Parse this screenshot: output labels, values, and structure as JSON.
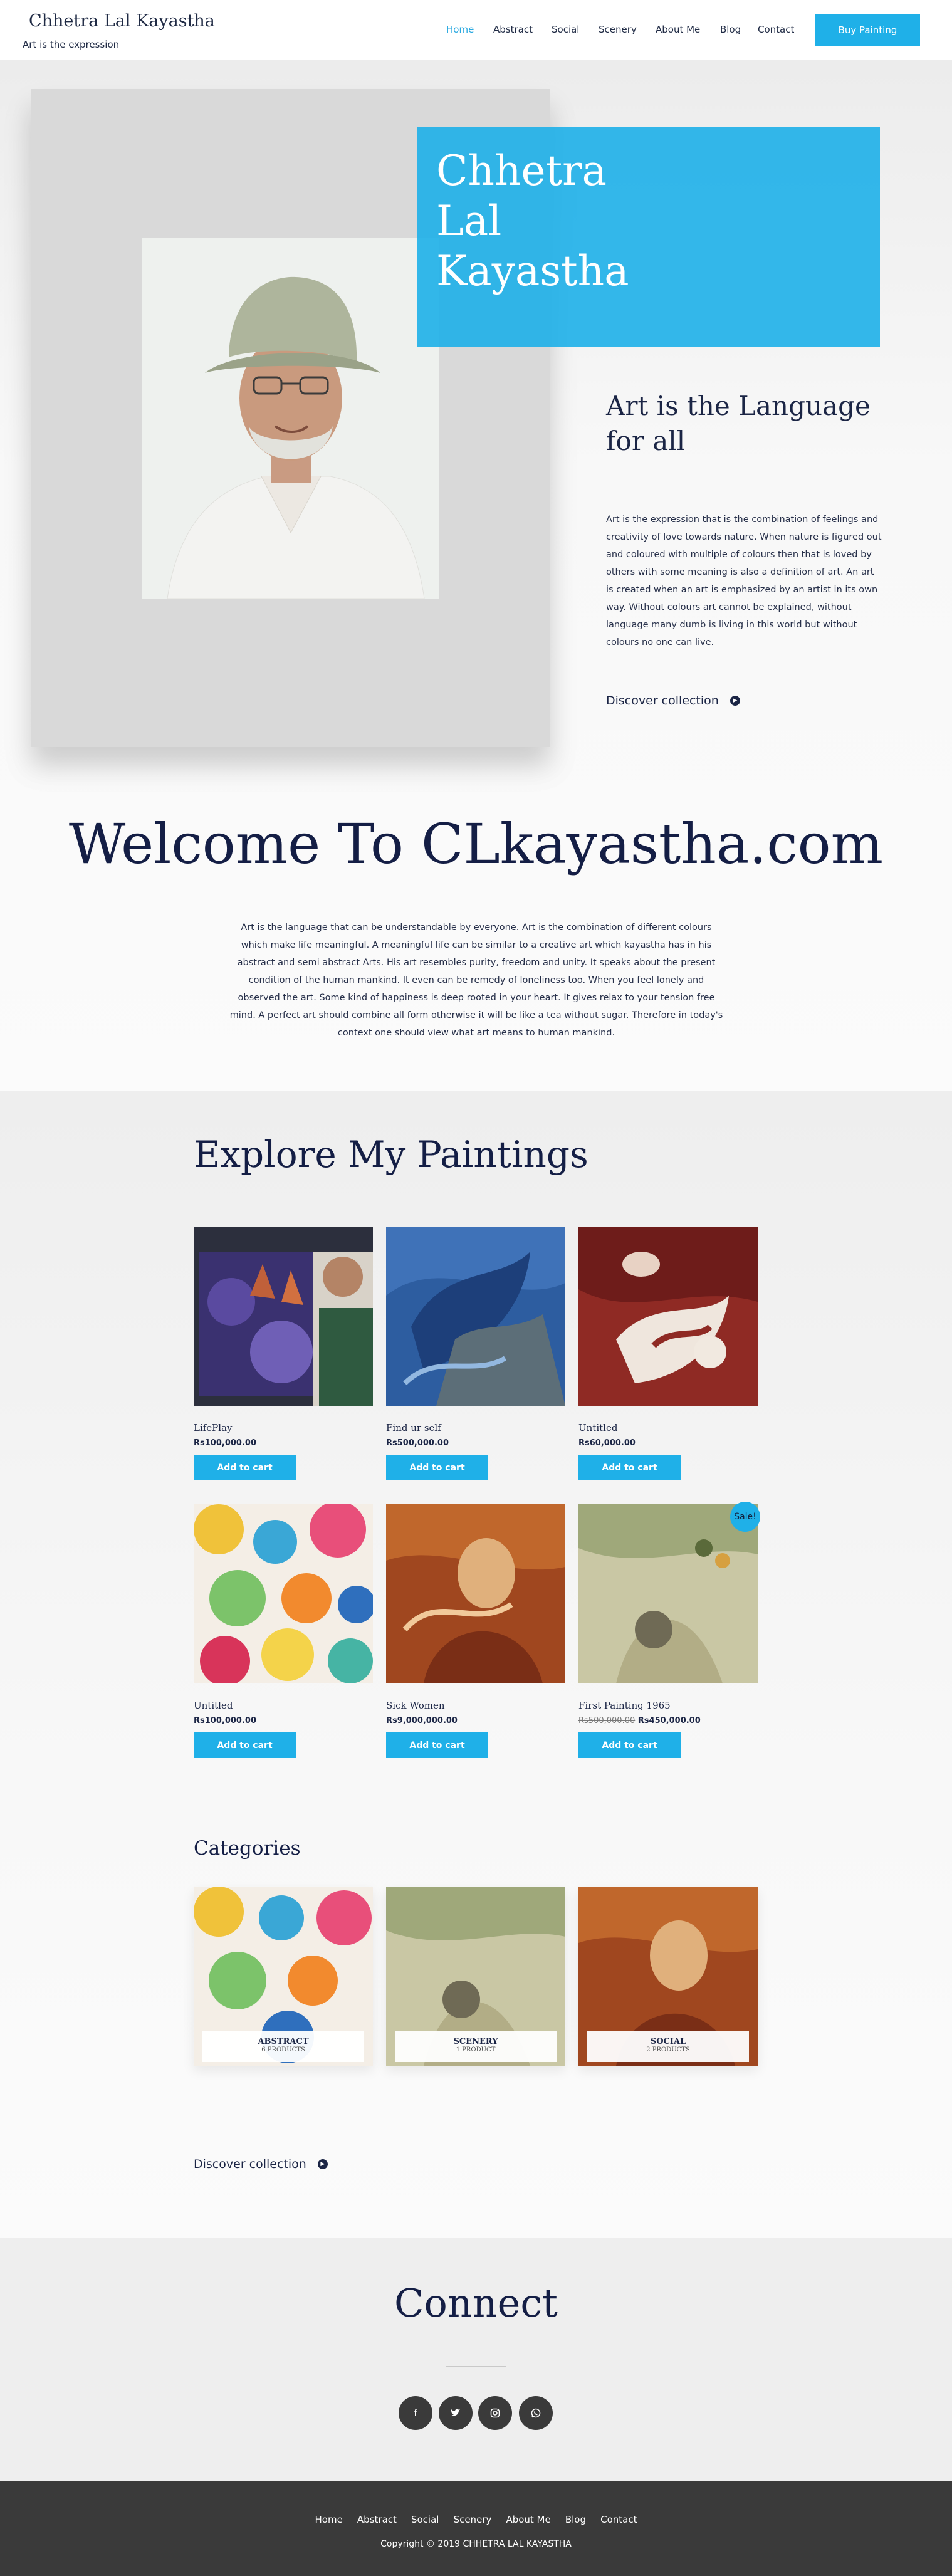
{
  "header": {
    "site_title": "Chhetra Lal Kayastha",
    "tagline": "Art is the expression",
    "nav": [
      "Home",
      "Abstract",
      "Social",
      "Scenery",
      "About Me",
      "Blog",
      "Contact"
    ],
    "buy_button": "Buy Painting"
  },
  "hero": {
    "title": "Chhetra Lal Kayastha",
    "subtitle": "Art is the Language for all",
    "body": "Art is the expression that is the combination of feelings and creativity of love towards nature. When nature is figured out and coloured with multiple of colours then that is loved by others with some meaning is also a definition of art. An art is created when an art is emphasized by an artist in its own way. Without colours art cannot be explained, without language many dumb is living in this world but without colours no one can live.",
    "discover": "Discover collection"
  },
  "welcome": {
    "title": "Welcome To CLkayastha.com",
    "body": "Art is the language that can be understandable by everyone. Art is the combination of different colours which make life meaningful. A meaningful life can be similar to a creative art which kayastha has in his abstract and semi abstract Arts. His art resembles purity, freedom and unity. It speaks about the present condition of the human mankind. It even can be remedy of loneliness too. When you feel lonely and observed the art. Some kind of happiness is deep rooted in your heart. It gives relax to your tension free mind. A perfect art should combine all form otherwise it will be like a tea without sugar. Therefore in today's context one should view what art means to human mankind."
  },
  "paintings": {
    "title": "Explore My Paintings",
    "cart_label": "Add to cart",
    "sale_label": "Sale!",
    "items": [
      {
        "name": "LifePlay",
        "price": "Rs100,000.00",
        "old_price": ""
      },
      {
        "name": "Find ur self",
        "price": "Rs500,000.00",
        "old_price": ""
      },
      {
        "name": "Untitled",
        "price": "Rs60,000.00",
        "old_price": ""
      },
      {
        "name": "Untitled",
        "price": "Rs100,000.00",
        "old_price": ""
      },
      {
        "name": "Sick Women",
        "price": "Rs9,000,000.00",
        "old_price": ""
      },
      {
        "name": "First Painting 1965",
        "price": "Rs450,000.00",
        "old_price": "Rs500,000.00"
      }
    ]
  },
  "categories": {
    "title": "Categories",
    "items": [
      {
        "name": "ABSTRACT",
        "count": "6 PRODUCTS"
      },
      {
        "name": "SCENERY",
        "count": "1 PRODUCT"
      },
      {
        "name": "SOCIAL",
        "count": "2 PRODUCTS"
      }
    ],
    "discover": "Discover collection"
  },
  "connect": {
    "title": "Connect",
    "icons": [
      "facebook-icon",
      "twitter-icon",
      "instagram-icon",
      "whatsapp-icon"
    ]
  },
  "footer": {
    "nav": [
      "Home",
      "Abstract",
      "Social",
      "Scenery",
      "About Me",
      "Blog",
      "Contact"
    ],
    "copyright": "Copyright © 2019 CHHETRA LAL KAYASTHA"
  },
  "colors": {
    "accent": "#1fb0e8",
    "navy": "#141e45",
    "footer": "#3a3a3a"
  }
}
